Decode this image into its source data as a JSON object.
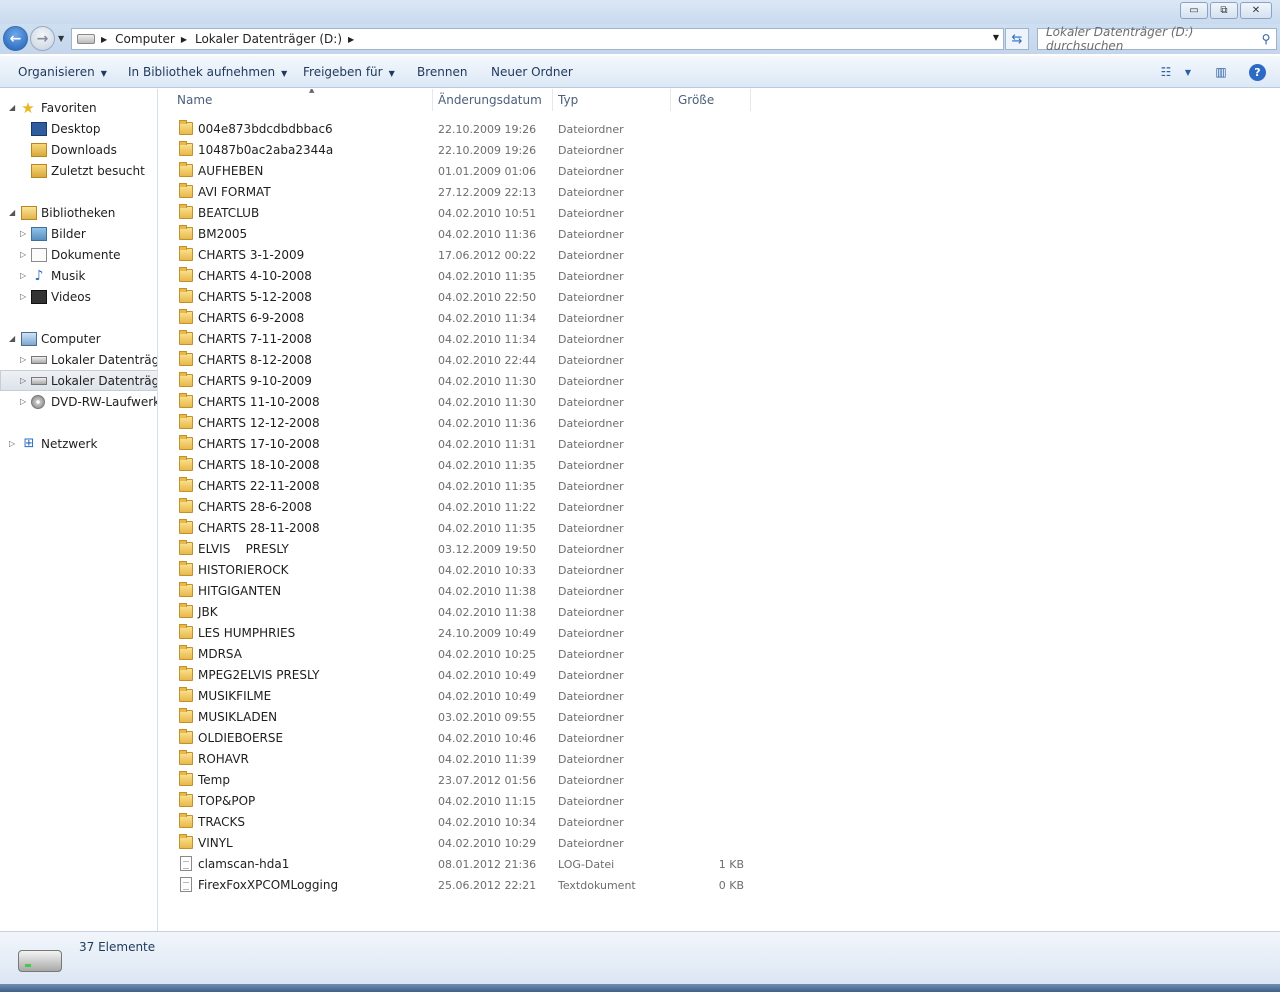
{
  "window": {
    "minimize_glyph": "▭",
    "maximize_glyph": "⧉",
    "close_glyph": "✕"
  },
  "address": {
    "crumbs": [
      "Computer",
      "Lokaler Datenträger (D:)"
    ],
    "search_placeholder": "Lokaler Datenträger (D:) durchsuchen"
  },
  "toolbar": {
    "organize": "Organisieren",
    "library": "In Bibliothek aufnehmen",
    "share": "Freigeben für",
    "burn": "Brennen",
    "new_folder": "Neuer Ordner"
  },
  "sidebar": {
    "favorites": "Favoriten",
    "favorites_items": [
      "Desktop",
      "Downloads",
      "Zuletzt besucht"
    ],
    "libraries": "Bibliotheken",
    "libraries_items": [
      "Bilder",
      "Dokumente",
      "Musik",
      "Videos"
    ],
    "computer": "Computer",
    "computer_items": [
      "Lokaler Datenträger",
      "Lokaler Datenträger",
      "DVD-RW-Laufwerk ("
    ],
    "network": "Netzwerk"
  },
  "columns": {
    "name": "Name",
    "date": "Änderungsdatum",
    "type": "Typ",
    "size": "Größe"
  },
  "files": [
    {
      "name": "004e873bdcdbdbbac6",
      "date": "22.10.2009 19:26",
      "type": "Dateiordner",
      "size": "",
      "kind": "folder"
    },
    {
      "name": "10487b0ac2aba2344a",
      "date": "22.10.2009 19:26",
      "type": "Dateiordner",
      "size": "",
      "kind": "folder"
    },
    {
      "name": "AUFHEBEN",
      "date": "01.01.2009 01:06",
      "type": "Dateiordner",
      "size": "",
      "kind": "folder"
    },
    {
      "name": "AVI FORMAT",
      "date": "27.12.2009 22:13",
      "type": "Dateiordner",
      "size": "",
      "kind": "folder"
    },
    {
      "name": "BEATCLUB",
      "date": "04.02.2010 10:51",
      "type": "Dateiordner",
      "size": "",
      "kind": "folder"
    },
    {
      "name": "BM2005",
      "date": "04.02.2010 11:36",
      "type": "Dateiordner",
      "size": "",
      "kind": "folder"
    },
    {
      "name": "CHARTS 3-1-2009",
      "date": "17.06.2012 00:22",
      "type": "Dateiordner",
      "size": "",
      "kind": "folder"
    },
    {
      "name": "CHARTS 4-10-2008",
      "date": "04.02.2010 11:35",
      "type": "Dateiordner",
      "size": "",
      "kind": "folder"
    },
    {
      "name": "CHARTS 5-12-2008",
      "date": "04.02.2010 22:50",
      "type": "Dateiordner",
      "size": "",
      "kind": "folder"
    },
    {
      "name": "CHARTS 6-9-2008",
      "date": "04.02.2010 11:34",
      "type": "Dateiordner",
      "size": "",
      "kind": "folder"
    },
    {
      "name": "CHARTS 7-11-2008",
      "date": "04.02.2010 11:34",
      "type": "Dateiordner",
      "size": "",
      "kind": "folder"
    },
    {
      "name": "CHARTS 8-12-2008",
      "date": "04.02.2010 22:44",
      "type": "Dateiordner",
      "size": "",
      "kind": "folder"
    },
    {
      "name": "CHARTS 9-10-2009",
      "date": "04.02.2010 11:30",
      "type": "Dateiordner",
      "size": "",
      "kind": "folder"
    },
    {
      "name": "CHARTS 11-10-2008",
      "date": "04.02.2010 11:30",
      "type": "Dateiordner",
      "size": "",
      "kind": "folder"
    },
    {
      "name": "CHARTS 12-12-2008",
      "date": "04.02.2010 11:36",
      "type": "Dateiordner",
      "size": "",
      "kind": "folder"
    },
    {
      "name": "CHARTS 17-10-2008",
      "date": "04.02.2010 11:31",
      "type": "Dateiordner",
      "size": "",
      "kind": "folder"
    },
    {
      "name": "CHARTS 18-10-2008",
      "date": "04.02.2010 11:35",
      "type": "Dateiordner",
      "size": "",
      "kind": "folder"
    },
    {
      "name": "CHARTS 22-11-2008",
      "date": "04.02.2010 11:35",
      "type": "Dateiordner",
      "size": "",
      "kind": "folder"
    },
    {
      "name": "CHARTS 28-6-2008",
      "date": "04.02.2010 11:22",
      "type": "Dateiordner",
      "size": "",
      "kind": "folder"
    },
    {
      "name": "CHARTS 28-11-2008",
      "date": "04.02.2010 11:35",
      "type": "Dateiordner",
      "size": "",
      "kind": "folder"
    },
    {
      "name": "ELVIS    PRESLY",
      "date": "03.12.2009 19:50",
      "type": "Dateiordner",
      "size": "",
      "kind": "folder"
    },
    {
      "name": "HISTORIEROCK",
      "date": "04.02.2010 10:33",
      "type": "Dateiordner",
      "size": "",
      "kind": "folder"
    },
    {
      "name": "HITGIGANTEN",
      "date": "04.02.2010 11:38",
      "type": "Dateiordner",
      "size": "",
      "kind": "folder"
    },
    {
      "name": "JBK",
      "date": "04.02.2010 11:38",
      "type": "Dateiordner",
      "size": "",
      "kind": "folder"
    },
    {
      "name": "LES HUMPHRIES",
      "date": "24.10.2009 10:49",
      "type": "Dateiordner",
      "size": "",
      "kind": "folder"
    },
    {
      "name": "MDRSA",
      "date": "04.02.2010 10:25",
      "type": "Dateiordner",
      "size": "",
      "kind": "folder"
    },
    {
      "name": "MPEG2ELVIS PRESLY",
      "date": "04.02.2010 10:49",
      "type": "Dateiordner",
      "size": "",
      "kind": "folder"
    },
    {
      "name": "MUSIKFILME",
      "date": "04.02.2010 10:49",
      "type": "Dateiordner",
      "size": "",
      "kind": "folder"
    },
    {
      "name": "MUSIKLADEN",
      "date": "03.02.2010 09:55",
      "type": "Dateiordner",
      "size": "",
      "kind": "folder"
    },
    {
      "name": "OLDIEBOERSE",
      "date": "04.02.2010 10:46",
      "type": "Dateiordner",
      "size": "",
      "kind": "folder"
    },
    {
      "name": "ROHAVR",
      "date": "04.02.2010 11:39",
      "type": "Dateiordner",
      "size": "",
      "kind": "folder"
    },
    {
      "name": "Temp",
      "date": "23.07.2012 01:56",
      "type": "Dateiordner",
      "size": "",
      "kind": "folder"
    },
    {
      "name": "TOP&POP",
      "date": "04.02.2010 11:15",
      "type": "Dateiordner",
      "size": "",
      "kind": "folder"
    },
    {
      "name": "TRACKS",
      "date": "04.02.2010 10:34",
      "type": "Dateiordner",
      "size": "",
      "kind": "folder"
    },
    {
      "name": "VINYL",
      "date": "04.02.2010 10:29",
      "type": "Dateiordner",
      "size": "",
      "kind": "folder"
    },
    {
      "name": "clamscan-hda1",
      "date": "08.01.2012 21:36",
      "type": "LOG-Datei",
      "size": "1 KB",
      "kind": "file"
    },
    {
      "name": "FirexFoxXPCOMLogging",
      "date": "25.06.2012 22:21",
      "type": "Textdokument",
      "size": "0 KB",
      "kind": "file"
    }
  ],
  "status": {
    "count": "37 Elemente"
  }
}
